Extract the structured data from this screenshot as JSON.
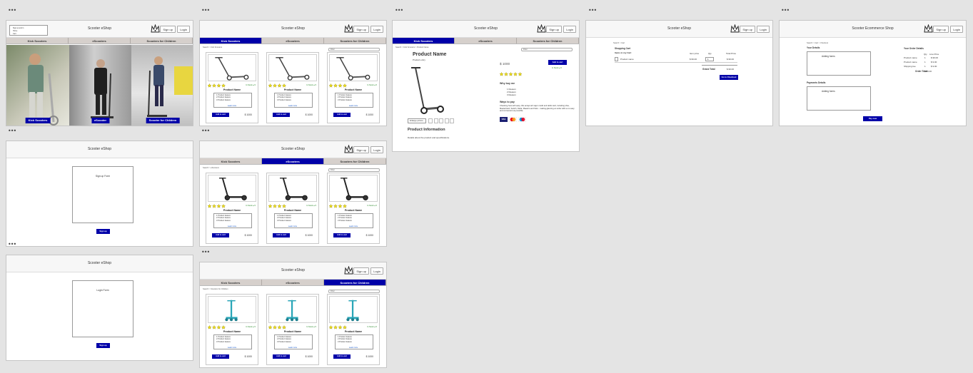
{
  "shop": {
    "title": "Scooter eShop",
    "title_full": "Scooter Ecommerce Shop",
    "signup": "Sign up",
    "login": "Login"
  },
  "nav": [
    "Kick Scooters",
    "eScooters",
    "Scooters for Children"
  ],
  "home": {
    "menu": [
      "Sign up and in",
      "Home",
      "Cart"
    ],
    "hero_captions": [
      "Kick Scooters",
      "eScooter",
      "Scooter for Children"
    ]
  },
  "card": {
    "product_name": "Product Name",
    "features": [
      "1 Product feature",
      "2 Product feature",
      "3 Product feature"
    ],
    "learn_more": "Learn more",
    "add_btn": "Add to cart",
    "price": "$ 1000",
    "stock": "In Stock ● 5"
  },
  "breadcrumbs": {
    "kick": "Search > Kick Scooters",
    "escooters": "Search > eScooters",
    "children": "Search > Scooters for Children",
    "product": "Search > Kick Scooters > Product Name",
    "cart": "Search > Cart",
    "checkout": "Search > Cart > Checkout"
  },
  "filter_label": "Filter",
  "product_page": {
    "name": "Product Name",
    "model": "Product entry",
    "price": "$ 1000",
    "add_btn": "Add to cart",
    "stock": "In Stock ● 5",
    "why_heading": "Why buy me",
    "reasons": [
      "1 Reason",
      "2 Reason",
      "3 Reason"
    ],
    "pay_heading": "Ways to pay",
    "pay_text": "Checking how with easy. We accept all major credit and debit card, including Visa, MasterCard, Switch, Delta, Maestro and Solo - making glancing an order with us is easy and convenient as possible.",
    "enlarge": "Enlarge picture",
    "info_heading": "Product Information",
    "info_text": "Details about the product and specifications.",
    "cards": [
      "VISA",
      "MC",
      "MAESTRO"
    ]
  },
  "cart": {
    "heading": "Shopping Cart",
    "items_label": "Items in my Cart",
    "col_item_price": "Item price",
    "col_qty": "Qty",
    "col_total": "Total Price",
    "row_name": "Product name",
    "row_price": "$ 99.00",
    "row_qty": "1",
    "row_total": "$ 99.00",
    "grand_label": "Grand Total",
    "grand_value": "$ 99.00",
    "checkout_btn": "Go to Checkout"
  },
  "checkout": {
    "your_details": "Your Details",
    "adding_forms": "Adding forms",
    "payment_details": "Payments Details",
    "order_details": "Your Order Details",
    "col_qty": "Qty",
    "col_line": "Line Price",
    "rows": [
      {
        "name": "Product name",
        "qty": "1",
        "price": "$ 99.00"
      },
      {
        "name": "Product name",
        "qty": "1",
        "price": "$ 9.00"
      },
      {
        "name": "Shipping fee",
        "qty": "1",
        "price": "$ 9.00"
      }
    ],
    "order_total_label": "Order Total",
    "order_total_value": "$ 99.00",
    "pay_btn": "Pay now"
  },
  "signup_page": {
    "form": "Sign up Form",
    "btn": "Sign up"
  },
  "login_page": {
    "form": "Login Form",
    "btn": "Sign up"
  },
  "colors": {
    "accent": "#0000a8",
    "nav_bg": "#d6d0cc",
    "star": "#f5e617",
    "stock": "#2a8a2a"
  },
  "rating": {
    "stars": 4,
    "max": 5
  }
}
